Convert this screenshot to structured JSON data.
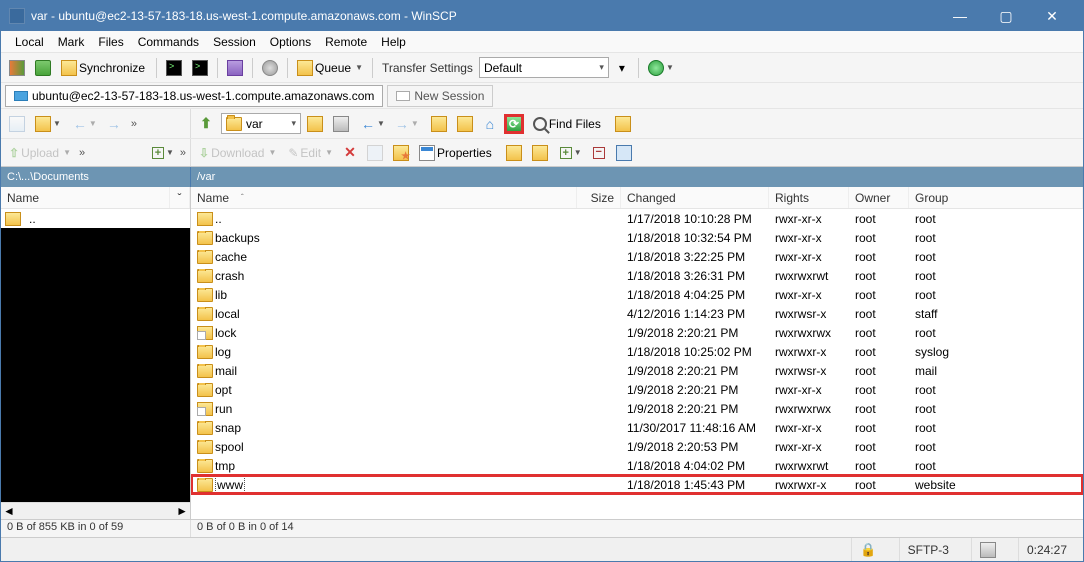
{
  "window": {
    "title": "var - ubuntu@ec2-13-57-183-18.us-west-1.compute.amazonaws.com - WinSCP"
  },
  "menus": [
    "Local",
    "Mark",
    "Files",
    "Commands",
    "Session",
    "Options",
    "Remote",
    "Help"
  ],
  "toolbar1": {
    "synchronize": "Synchronize",
    "queue": "Queue",
    "transfer_settings_label": "Transfer Settings",
    "transfer_preset": "Default"
  },
  "session": {
    "current": "ubuntu@ec2-13-57-183-18.us-west-1.compute.amazonaws.com",
    "new": "New Session"
  },
  "nav": {
    "remote_dir": "var",
    "find_files": "Find Files"
  },
  "actions": {
    "upload": "Upload",
    "download": "Download",
    "edit": "Edit",
    "properties": "Properties"
  },
  "paths": {
    "local": "C:\\...\\Documents",
    "remote": "/var"
  },
  "columns_local": {
    "name": "Name"
  },
  "columns_remote": {
    "name": "Name",
    "size": "Size",
    "changed": "Changed",
    "rights": "Rights",
    "owner": "Owner",
    "group": "Group"
  },
  "local_rows": [
    {
      "name": ".."
    }
  ],
  "remote_rows": [
    {
      "type": "parent",
      "name": "..",
      "size": "",
      "changed": "1/17/2018 10:10:28 PM",
      "rights": "rwxr-xr-x",
      "owner": "root",
      "group": "root"
    },
    {
      "type": "folder",
      "name": "backups",
      "size": "",
      "changed": "1/18/2018 10:32:54 PM",
      "rights": "rwxr-xr-x",
      "owner": "root",
      "group": "root"
    },
    {
      "type": "folder",
      "name": "cache",
      "size": "",
      "changed": "1/18/2018 3:22:25 PM",
      "rights": "rwxr-xr-x",
      "owner": "root",
      "group": "root"
    },
    {
      "type": "folder",
      "name": "crash",
      "size": "",
      "changed": "1/18/2018 3:26:31 PM",
      "rights": "rwxrwxrwt",
      "owner": "root",
      "group": "root"
    },
    {
      "type": "folder",
      "name": "lib",
      "size": "",
      "changed": "1/18/2018 4:04:25 PM",
      "rights": "rwxr-xr-x",
      "owner": "root",
      "group": "root"
    },
    {
      "type": "folder",
      "name": "local",
      "size": "",
      "changed": "4/12/2016 1:14:23 PM",
      "rights": "rwxrwsr-x",
      "owner": "root",
      "group": "staff"
    },
    {
      "type": "link",
      "name": "lock",
      "size": "",
      "changed": "1/9/2018 2:20:21 PM",
      "rights": "rwxrwxrwx",
      "owner": "root",
      "group": "root"
    },
    {
      "type": "folder",
      "name": "log",
      "size": "",
      "changed": "1/18/2018 10:25:02 PM",
      "rights": "rwxrwxr-x",
      "owner": "root",
      "group": "syslog"
    },
    {
      "type": "folder",
      "name": "mail",
      "size": "",
      "changed": "1/9/2018 2:20:21 PM",
      "rights": "rwxrwsr-x",
      "owner": "root",
      "group": "mail"
    },
    {
      "type": "folder",
      "name": "opt",
      "size": "",
      "changed": "1/9/2018 2:20:21 PM",
      "rights": "rwxr-xr-x",
      "owner": "root",
      "group": "root"
    },
    {
      "type": "link",
      "name": "run",
      "size": "",
      "changed": "1/9/2018 2:20:21 PM",
      "rights": "rwxrwxrwx",
      "owner": "root",
      "group": "root"
    },
    {
      "type": "folder",
      "name": "snap",
      "size": "",
      "changed": "11/30/2017 11:48:16 AM",
      "rights": "rwxr-xr-x",
      "owner": "root",
      "group": "root"
    },
    {
      "type": "folder",
      "name": "spool",
      "size": "",
      "changed": "1/9/2018 2:20:53 PM",
      "rights": "rwxr-xr-x",
      "owner": "root",
      "group": "root"
    },
    {
      "type": "folder",
      "name": "tmp",
      "size": "",
      "changed": "1/18/2018 4:04:02 PM",
      "rights": "rwxrwxrwt",
      "owner": "root",
      "group": "root"
    },
    {
      "type": "folder",
      "name": "www",
      "size": "",
      "changed": "1/18/2018 1:45:43 PM",
      "rights": "rwxrwxr-x",
      "owner": "root",
      "group": "website",
      "highlight": true,
      "boxed": true
    }
  ],
  "footer": {
    "local": "0 B of 855 KB in 0 of 59",
    "remote": "0 B of 0 B in 0 of 14"
  },
  "status": {
    "protocol": "SFTP-3",
    "elapsed": "0:24:27"
  }
}
